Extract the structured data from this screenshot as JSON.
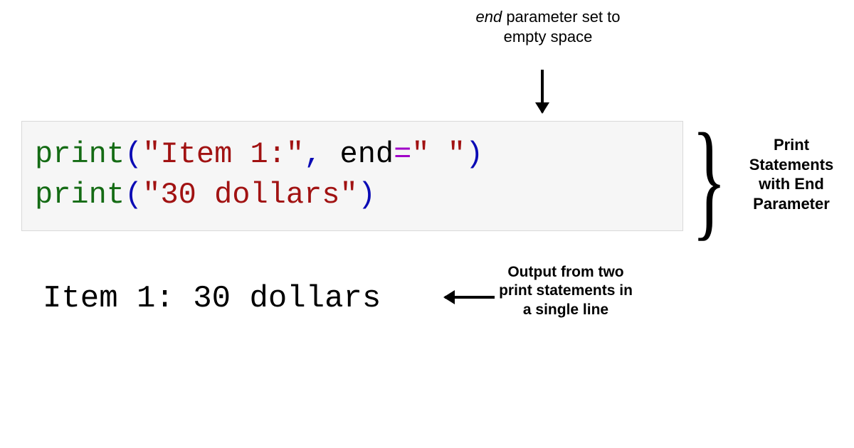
{
  "annotations": {
    "top_em": "end",
    "top_rest": " parameter set to empty space",
    "brace_label": "Print Statements with End Parameter",
    "output_label": "Output from two print statements in a single line"
  },
  "code": {
    "line1": {
      "fn": "print",
      "open": "(",
      "str1": "\"Item 1:\"",
      "comma": ", ",
      "kw": "end",
      "eq": "=",
      "str2": "\" \"",
      "close": ")"
    },
    "line2": {
      "fn": "print",
      "open": "(",
      "str1": "\"30 dollars\"",
      "close": ")"
    }
  },
  "output_text": "Item 1: 30 dollars",
  "chart_data": {
    "type": "table",
    "title": "Python print() end parameter example",
    "code_lines": [
      "print(\"Item 1:\", end=\" \")",
      "print(\"30 dollars\")"
    ],
    "stdout": "Item 1: 30 dollars",
    "annotations": [
      "end parameter set to empty space",
      "Print Statements with End Parameter",
      "Output from two print statements in a single line"
    ]
  }
}
